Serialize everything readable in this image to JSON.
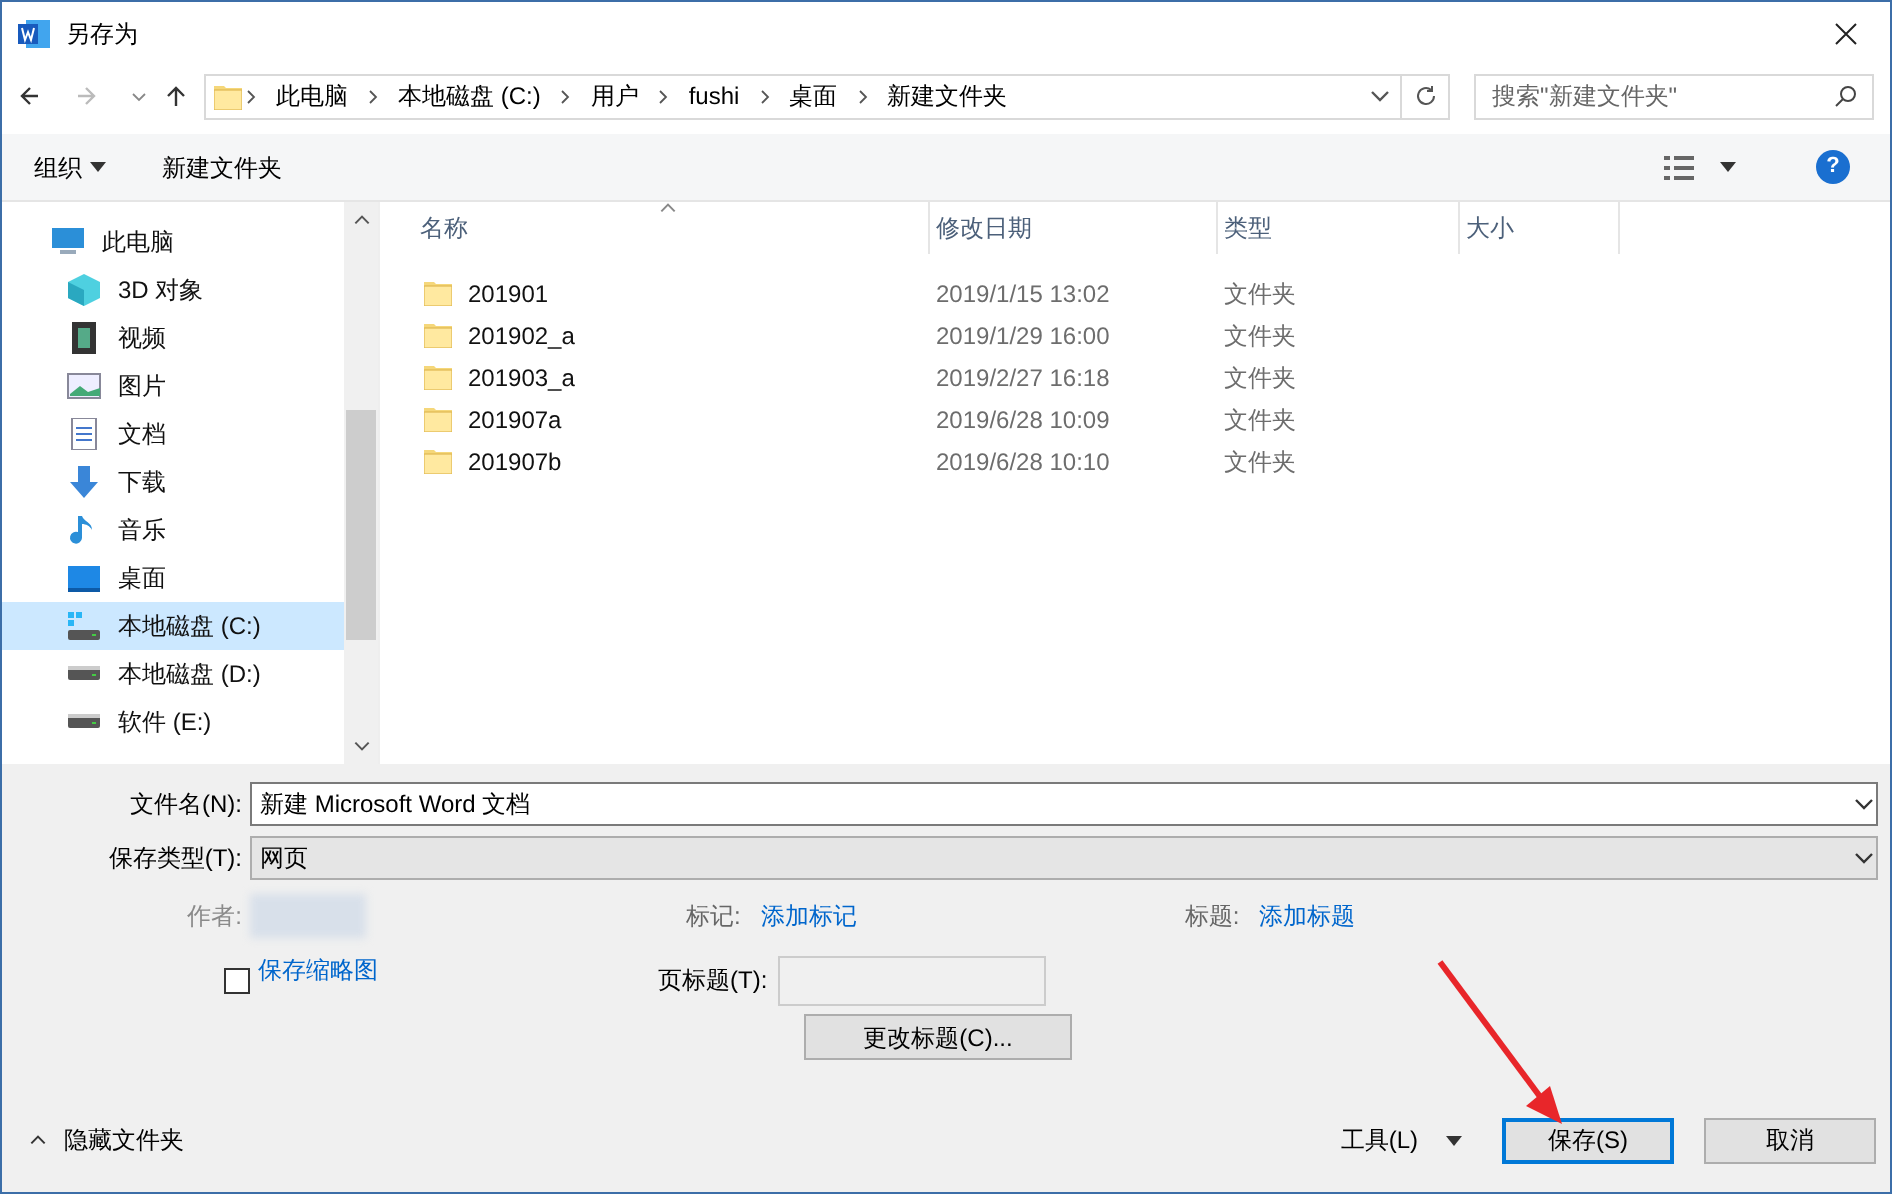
{
  "window": {
    "title": "另存为"
  },
  "breadcrumb": [
    "此电脑",
    "本地磁盘 (C:)",
    "用户",
    "fushi",
    "桌面",
    "新建文件夹"
  ],
  "search": {
    "placeholder": "搜索\"新建文件夹\""
  },
  "toolbar": {
    "organize": "组织",
    "new_folder": "新建文件夹",
    "help": "?"
  },
  "nav": [
    {
      "label": "此电脑",
      "kind": "pc",
      "selected": false,
      "children": [
        {
          "label": "3D 对象",
          "kind": "cube",
          "selected": false
        },
        {
          "label": "视频",
          "kind": "video",
          "selected": false
        },
        {
          "label": "图片",
          "kind": "picture",
          "selected": false
        },
        {
          "label": "文档",
          "kind": "document",
          "selected": false
        },
        {
          "label": "下载",
          "kind": "download",
          "selected": false
        },
        {
          "label": "音乐",
          "kind": "music",
          "selected": false
        },
        {
          "label": "桌面",
          "kind": "desktop",
          "selected": false
        },
        {
          "label": "本地磁盘 (C:)",
          "kind": "system-drive",
          "selected": true
        },
        {
          "label": "本地磁盘 (D:)",
          "kind": "drive",
          "selected": false
        },
        {
          "label": "软件 (E:)",
          "kind": "drive",
          "selected": false
        }
      ]
    }
  ],
  "table": {
    "columns": [
      "名称",
      "修改日期",
      "类型",
      "大小"
    ],
    "rows": [
      {
        "name": "201901",
        "date": "2019/1/15 13:02",
        "type": "文件夹"
      },
      {
        "name": "201902_a",
        "date": "2019/1/29 16:00",
        "type": "文件夹"
      },
      {
        "name": "201903_a",
        "date": "2019/2/27 16:18",
        "type": "文件夹"
      },
      {
        "name": "201907a",
        "date": "2019/6/28 10:09",
        "type": "文件夹"
      },
      {
        "name": "201907b",
        "date": "2019/6/28 10:10",
        "type": "文件夹"
      }
    ]
  },
  "form": {
    "filename_label": "文件名(N):",
    "filename": "新建 Microsoft Word 文档",
    "type_label": "保存类型(T):",
    "type": "网页",
    "author_label": "作者:",
    "tags_label": "标记:",
    "tags_link": "添加标记",
    "title_label": "标题:",
    "title_link": "添加标题",
    "thumbnail": {
      "label": "保存缩略图",
      "checked": false
    },
    "page_title_label": "页标题(T):",
    "change_title": "更改标题(C)..."
  },
  "footer": {
    "hide_folders": "隐藏文件夹",
    "tools": "工具(L)",
    "save": "保存(S)",
    "cancel": "取消"
  }
}
